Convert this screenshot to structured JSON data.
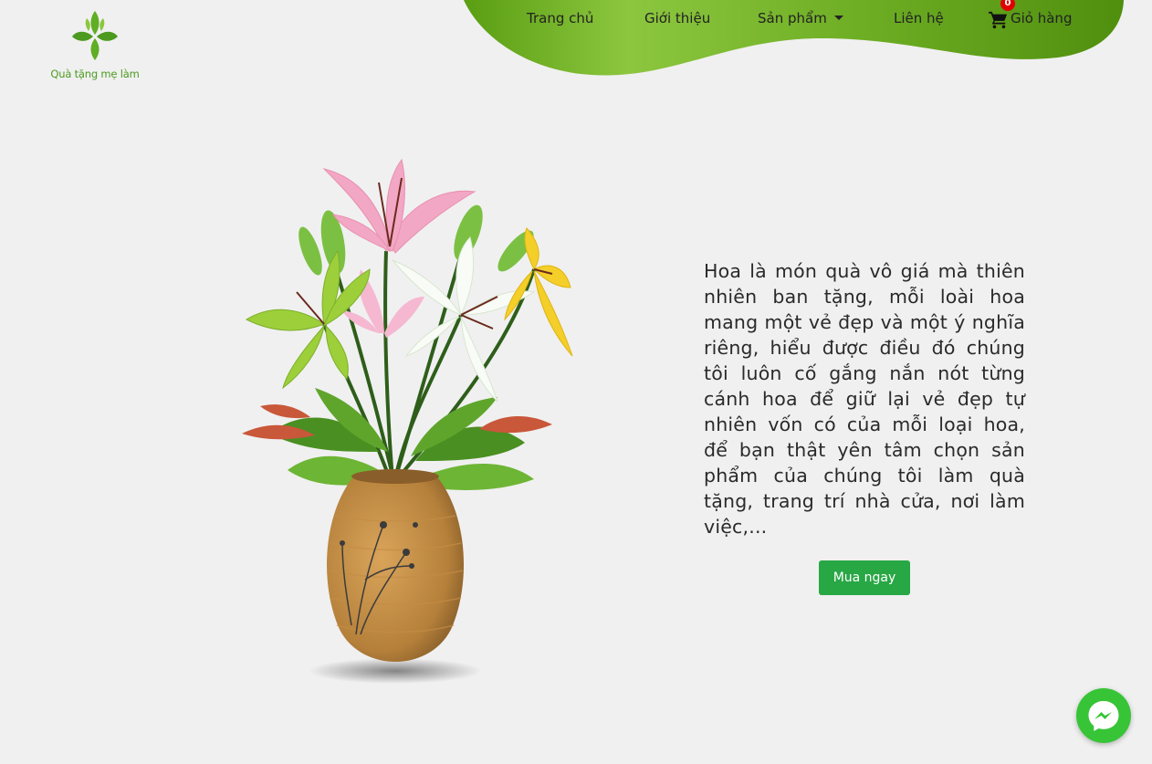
{
  "brand": {
    "logo_icon": "leaf-clover-icon",
    "name": "Quà tặng mẹ làm",
    "color": "#4c9a1f"
  },
  "nav": {
    "items": [
      {
        "label": "Trang chủ"
      },
      {
        "label": "Giới thiệu"
      },
      {
        "label": "Sản phẩm",
        "has_dropdown": true
      },
      {
        "label": "Liên hệ"
      }
    ],
    "cart": {
      "label": "Giỏ hàng",
      "count": "0",
      "icon": "shopping-cart-icon"
    },
    "background_gradient": [
      "#5a9e12",
      "#8cc63f",
      "#4f8f0e"
    ]
  },
  "hero": {
    "image": "flower-vase-image",
    "description": "Hoa là món quà vô giá mà thiên nhiên ban tặng, mỗi loài hoa mang một vẻ đẹp và một ý nghĩa riêng, hiểu được điều đó chúng tôi luôn cố gắng nắn nót từng cánh hoa để giữ lại vẻ đẹp tự nhiên vốn có của mỗi loại hoa, để bạn thật yên tâm chọn sản phẩm của chúng tôi làm quà tặng, trang trí nhà cửa, nơi làm việc,...",
    "cta_label": "Mua ngay",
    "cta_color": "#28a745"
  },
  "chat": {
    "icon": "messenger-icon",
    "color": "#37c437"
  }
}
